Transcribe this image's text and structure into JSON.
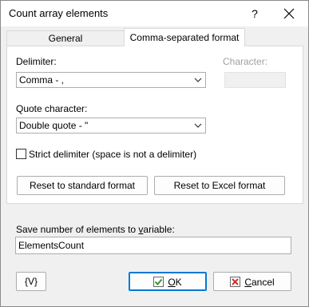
{
  "window": {
    "title": "Count array elements",
    "help_label": "?"
  },
  "tabs": [
    {
      "label": "General",
      "active": false
    },
    {
      "label": "Comma-separated format",
      "active": true
    }
  ],
  "delimiter": {
    "label": "Delimiter:",
    "value": "Comma - ,"
  },
  "character": {
    "label": "Character:",
    "value": ""
  },
  "quote": {
    "label": "Quote character:",
    "value": "Double quote - \""
  },
  "strict": {
    "label": "Strict delimiter (space is not a delimiter)",
    "checked": false
  },
  "buttons": {
    "reset_standard": "Reset to standard format",
    "reset_excel": "Reset to Excel format",
    "var": "{V}",
    "ok_prefix": "",
    "ok_underline": "O",
    "ok_rest": "K",
    "cancel_underline": "C",
    "cancel_rest": "ancel"
  },
  "variable": {
    "label_before": "Save number of elements to ",
    "label_underline": "v",
    "label_after": "ariable:",
    "value": "ElementsCount"
  },
  "colors": {
    "accent": "#0078d7",
    "ok_check": "#2e9b2e",
    "cancel_x": "#d22b2b"
  },
  "icons": {
    "ok": "check-icon",
    "cancel": "x-icon",
    "dropdown": "chevron-down-icon",
    "close": "close-icon"
  }
}
